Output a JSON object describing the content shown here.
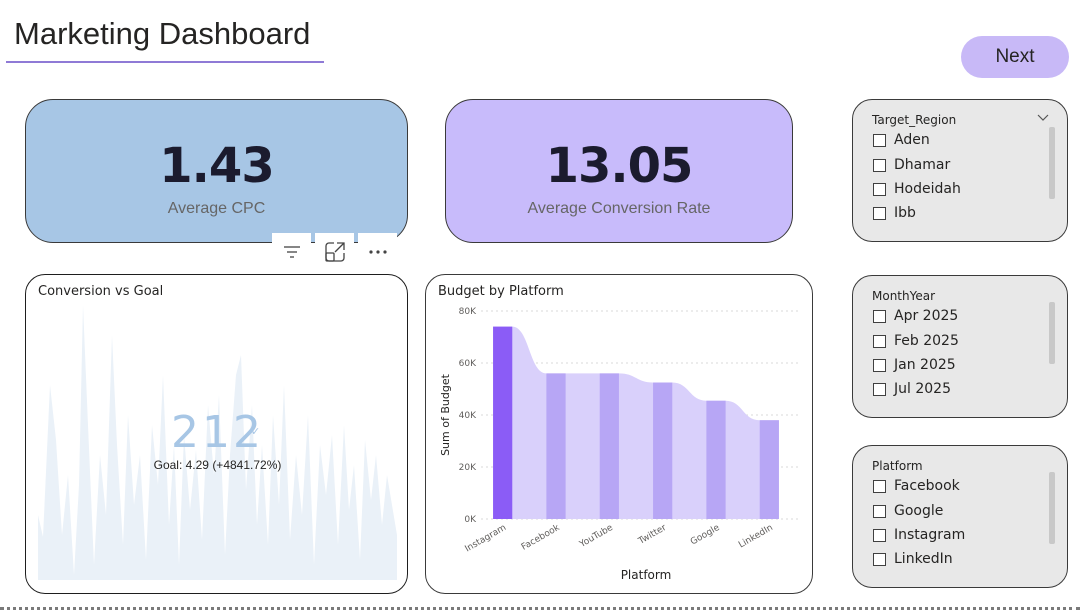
{
  "page": {
    "title": "Marketing Dashboard",
    "next_label": "Next"
  },
  "kpis": [
    {
      "value": "1.43",
      "label": "Average CPC",
      "bg": "#a7c6e5"
    },
    {
      "value": "13.05",
      "label": "Average Conversion Rate",
      "bg": "#c8bbfb"
    }
  ],
  "toolbar": {
    "filter_icon": "filter-icon",
    "focus_icon": "focus-mode-icon",
    "more_icon": "more-options-icon"
  },
  "gauge": {
    "title": "Conversion vs Goal",
    "value": "212",
    "goal": "Goal: 4.29 (+4841.72%)",
    "value_color": "#a7c6e5",
    "area_color": "#eaf1f8"
  },
  "chart_data": {
    "type": "bar",
    "title": "Budget by Platform",
    "xlabel": "Platform",
    "ylabel": "Sum of Budget",
    "categories": [
      "Instagram",
      "Facebook",
      "YouTube",
      "Twitter",
      "Google",
      "LinkedIn"
    ],
    "values": [
      74000,
      56000,
      56000,
      52500,
      45500,
      38000
    ],
    "yticks": [
      "0K",
      "20K",
      "40K",
      "60K",
      "80K"
    ],
    "ylim": [
      0,
      80000
    ],
    "grid": true,
    "colors": {
      "highlight": "#8b5cf6",
      "bar": "#b7a6f5",
      "ribbon": "#d9d0fb"
    }
  },
  "slicers": [
    {
      "title": "Target_Region",
      "items": [
        "Aden",
        "Dhamar",
        "Hodeidah",
        "Ibb"
      ],
      "chevron_icon": "chevron-down-icon"
    },
    {
      "title": "MonthYear",
      "items": [
        "Apr 2025",
        "Feb 2025",
        "Jan 2025",
        "Jul 2025"
      ]
    },
    {
      "title": "Platform",
      "items": [
        "Facebook",
        "Google",
        "Instagram",
        "LinkedIn"
      ]
    }
  ]
}
